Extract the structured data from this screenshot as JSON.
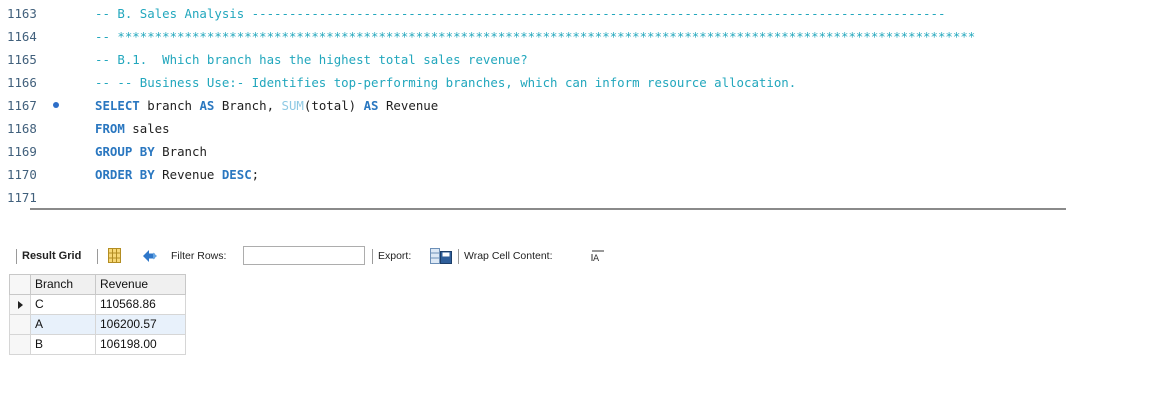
{
  "editor": {
    "lines": [
      {
        "number": "1163",
        "segments": [
          {
            "cls": "cmt",
            "text": "-- B. Sales Analysis ---------------------------------------------------------------------------------------------"
          }
        ]
      },
      {
        "number": "1164",
        "segments": [
          {
            "cls": "cmt",
            "text": "-- *******************************************************************************************************************"
          }
        ]
      },
      {
        "number": "1165",
        "segments": [
          {
            "cls": "cmt",
            "text": "-- B.1.  Which branch has the highest total sales revenue?"
          }
        ]
      },
      {
        "number": "1166",
        "segments": [
          {
            "cls": "cmt",
            "text": "-- -- Business Use:- Identifies top-performing branches, which can inform resource allocation."
          }
        ]
      },
      {
        "number": "1167",
        "breakpoint": true,
        "segments": [
          {
            "cls": "kw",
            "text": "SELECT"
          },
          {
            "cls": "id",
            "text": " branch "
          },
          {
            "cls": "kw",
            "text": "AS"
          },
          {
            "cls": "id",
            "text": " Branch, "
          },
          {
            "cls": "fn",
            "text": "SUM"
          },
          {
            "cls": "id",
            "text": "(total) "
          },
          {
            "cls": "kw",
            "text": "AS"
          },
          {
            "cls": "id",
            "text": " Revenue"
          }
        ]
      },
      {
        "number": "1168",
        "segments": [
          {
            "cls": "kw",
            "text": "FROM"
          },
          {
            "cls": "id",
            "text": " sales"
          }
        ]
      },
      {
        "number": "1169",
        "segments": [
          {
            "cls": "kw",
            "text": "GROUP BY"
          },
          {
            "cls": "id",
            "text": " Branch"
          }
        ]
      },
      {
        "number": "1170",
        "segments": [
          {
            "cls": "kw",
            "text": "ORDER BY"
          },
          {
            "cls": "id",
            "text": " Revenue "
          },
          {
            "cls": "kw",
            "text": "DESC"
          },
          {
            "cls": "id",
            "text": ";"
          }
        ]
      },
      {
        "number": "1171",
        "segments": []
      }
    ]
  },
  "toolbar": {
    "result_grid_label": "Result Grid",
    "filter_rows_label": "Filter Rows:",
    "filter_value": "",
    "export_label": "Export:",
    "wrap_label": "Wrap Cell Content:"
  },
  "grid": {
    "columns": [
      "Branch",
      "Revenue"
    ],
    "rows": [
      [
        "C",
        "110568.86"
      ],
      [
        "A",
        "106200.57"
      ],
      [
        "B",
        "106198.00"
      ]
    ],
    "selected_row": 0
  },
  "colors": {
    "comment": "#22a7bd",
    "keyword": "#2a77c0",
    "function": "#8ec9e4",
    "line_number": "#41607c",
    "breakpoint": "#2d6ec8",
    "row_highlight": "#e8f1fb"
  },
  "icons": [
    "breakpoint-dot-icon",
    "grid-view-icon",
    "refresh-icon",
    "export-save-icon",
    "wrap-text-icon",
    "row-selected-arrow-icon"
  ]
}
